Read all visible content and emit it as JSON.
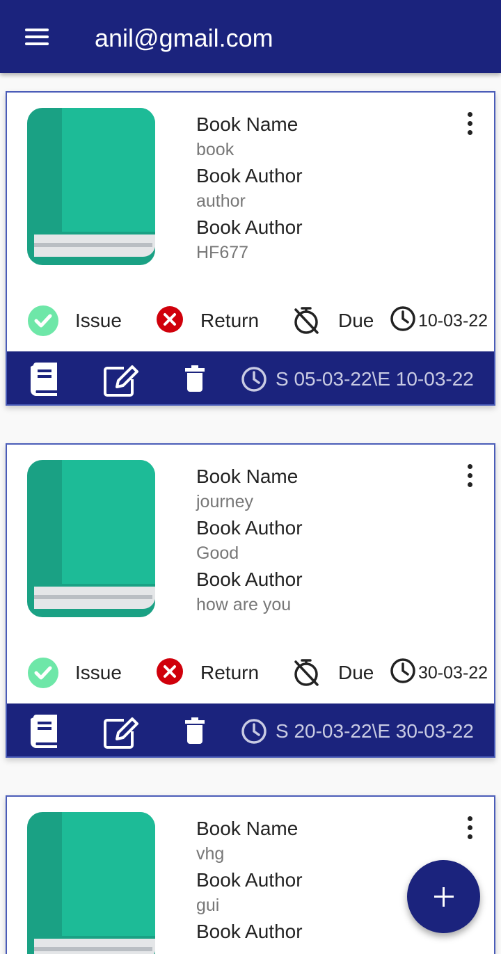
{
  "header": {
    "title": "anil@gmail.com",
    "menu_icon": "menu-icon"
  },
  "colors": {
    "primary": "#1b237d",
    "accent_green": "#1abc9c",
    "success": "#6ee7a8",
    "danger": "#d0000b"
  },
  "cards": [
    {
      "name_label": "Book Name",
      "name_value": "book",
      "author_label": "Book Author",
      "author_value": "author",
      "code_label": "Book Author",
      "code_value": "HF677",
      "issue_label": "Issue",
      "return_label": "Return",
      "due_label": "Due",
      "due_date": "10-03-22",
      "range": "S 05-03-22\\E 10-03-22"
    },
    {
      "name_label": "Book Name",
      "name_value": "journey",
      "author_label": "Book Author",
      "author_value": "Good",
      "code_label": "Book Author",
      "code_value": "how are you",
      "issue_label": "Issue",
      "return_label": "Return",
      "due_label": "Due",
      "due_date": "30-03-22",
      "range": "S 20-03-22\\E 30-03-22"
    },
    {
      "name_label": "Book Name",
      "name_value": "vhg",
      "author_label": "Book Author",
      "author_value": "gui",
      "code_label": "Book Author"
    }
  ],
  "fab": {
    "icon": "plus-icon"
  }
}
